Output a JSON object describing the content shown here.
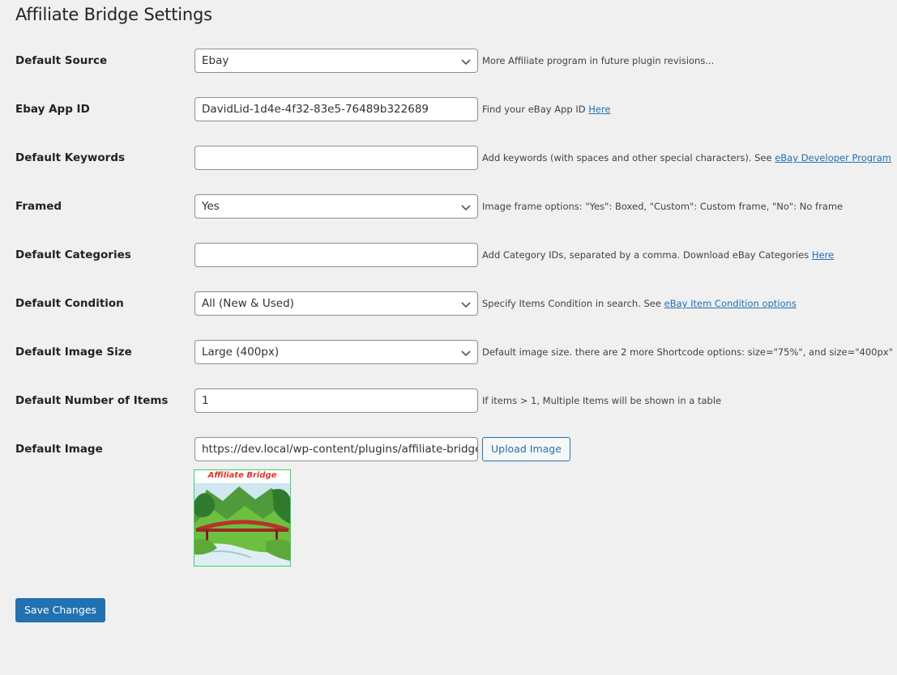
{
  "page": {
    "title": "Affiliate Bridge Settings"
  },
  "fields": {
    "source": {
      "label": "Default Source",
      "value": "Ebay",
      "desc": "More Affiliate program in future plugin revisions..."
    },
    "app_id": {
      "label": "Ebay App ID",
      "value": "DavidLid-1d4e-4f32-83e5-76489b322689",
      "desc": "Find your eBay App ID ",
      "link": "Here"
    },
    "keywords": {
      "label": "Default Keywords",
      "value": "",
      "desc": "Add keywords (with spaces and other special characters). See ",
      "link": "eBay Developer Program"
    },
    "framed": {
      "label": "Framed",
      "value": "Yes",
      "desc": "Image frame options: \"Yes\": Boxed, \"Custom\": Custom frame, \"No\": No frame"
    },
    "categories": {
      "label": "Default Categories",
      "value": "",
      "desc": "Add Category IDs, separated by a comma. Download eBay Categories ",
      "link": "Here"
    },
    "condition": {
      "label": "Default Condition",
      "value": "All (New & Used)",
      "desc": "Specify Items Condition in search. See ",
      "link": "eBay Item Condition options"
    },
    "image_size": {
      "label": "Default Image Size",
      "value": "Large (400px)",
      "desc": "Default image size. there are 2 more Shortcode options: size=\"75%\", and size=\"400px\""
    },
    "num_items": {
      "label": "Default Number of Items",
      "value": "1",
      "desc": "If items > 1, Multiple Items will be shown in a table"
    },
    "image": {
      "label": "Default Image",
      "value": "https://dev.local/wp-content/plugins/affiliate-bridge/assets/images/default.jpg",
      "upload_label": "Upload Image",
      "preview_text": "Affiliate Bridge"
    }
  },
  "actions": {
    "save_label": "Save Changes"
  },
  "colors": {
    "accent": "#2271b1",
    "background": "#f0f0f1",
    "preview_border": "#3ad46a",
    "preview_text": "#e3342f"
  }
}
